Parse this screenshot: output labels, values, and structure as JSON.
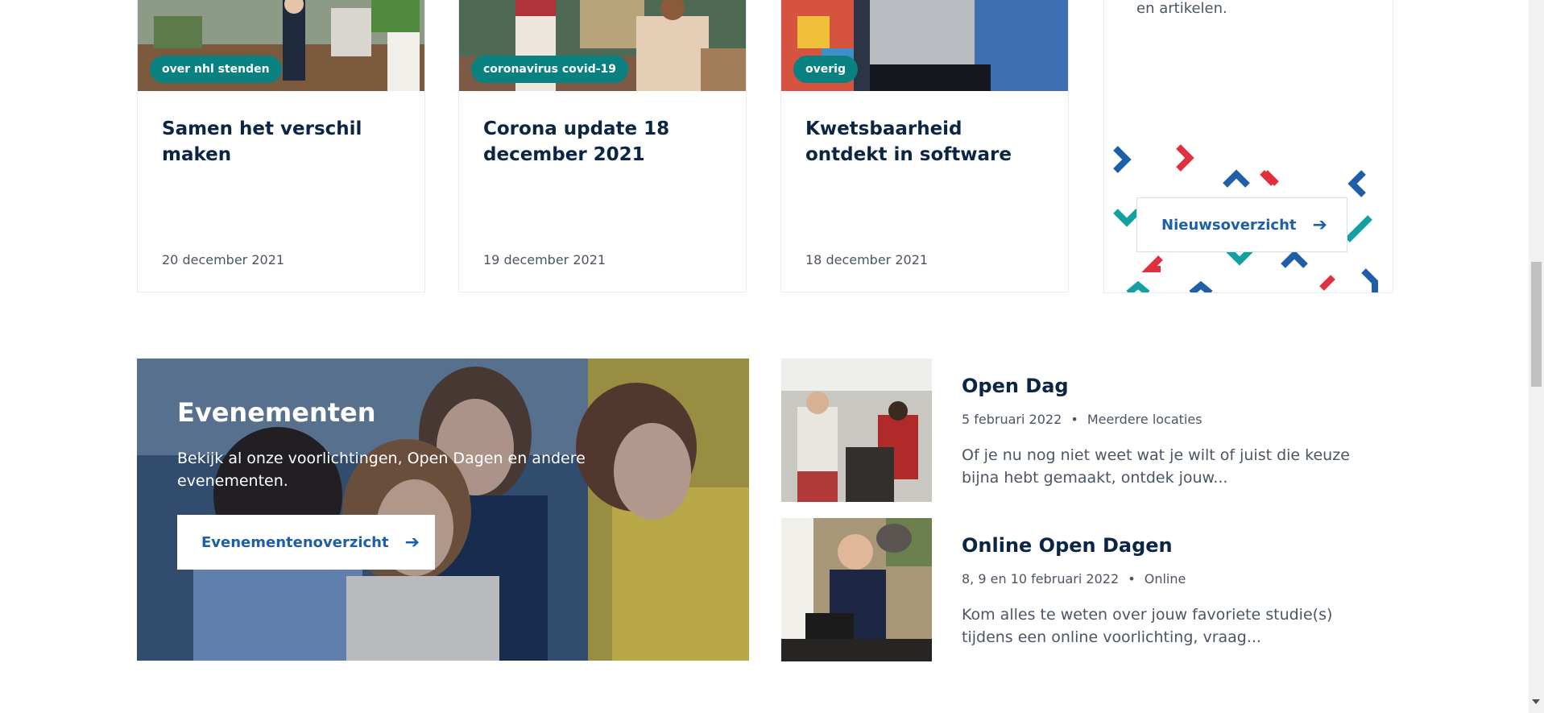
{
  "news": [
    {
      "tag": "over nhl stenden",
      "title": "Samen het verschil maken",
      "date": "20 december 2021"
    },
    {
      "tag": "coronavirus covid-19",
      "title": "Corona update 18 december 2021",
      "date": "19 december 2021"
    },
    {
      "tag": "overig",
      "title": "Kwetsbaarheid ontdekt in software",
      "date": "18 december 2021"
    }
  ],
  "promo": {
    "text": "en artikelen.",
    "button": "Nieuwsoverzicht",
    "arrow": "➔"
  },
  "events": {
    "title": "Evenementen",
    "description": "Bekijk al onze voorlichtingen, Open Dagen en andere evenementen.",
    "button": "Evenementenoverzicht",
    "arrow": "➔"
  },
  "event_items": [
    {
      "title": "Open Dag",
      "date": "5 februari 2022",
      "separator": "•",
      "location": "Meerdere locaties",
      "description": "Of je nu nog niet weet wat je wilt of juist die keuze bijna hebt gemaakt, ontdek jouw..."
    },
    {
      "title": "Online Open Dagen",
      "date": "8, 9 en 10 februari 2022",
      "separator": "•",
      "location": "Online",
      "description": "Kom alles te weten over jouw favoriete studie(s) tijdens een online voorlichting, vraag..."
    }
  ],
  "colors": {
    "tag": "#0a8181",
    "title": "#0b2545",
    "link": "#1d5fa8",
    "red": "#e0303d",
    "blue": "#1d5fa8",
    "teal": "#12a0a0"
  }
}
